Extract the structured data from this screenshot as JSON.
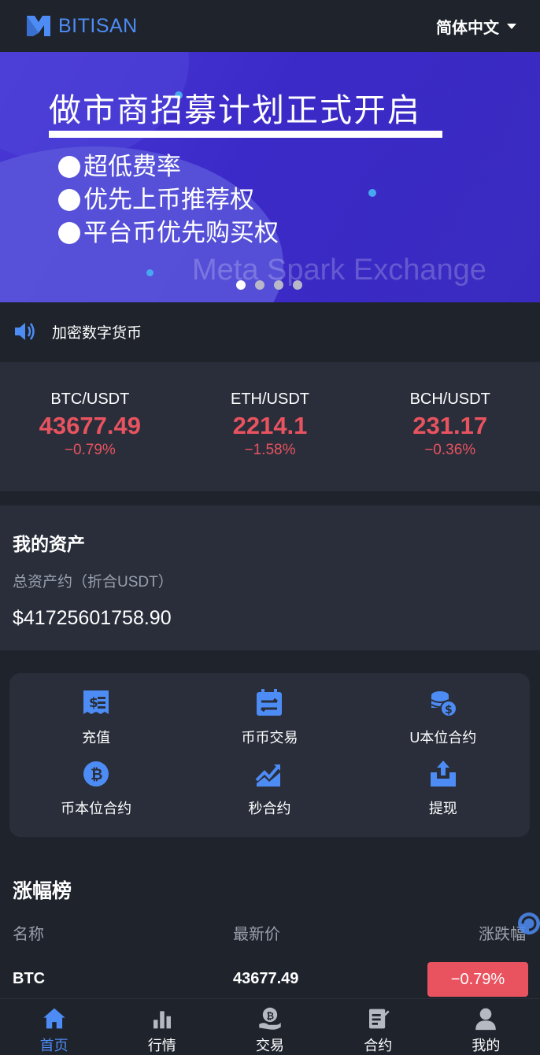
{
  "header": {
    "brand": "BITISAN",
    "language": "简体中文",
    "brand_color": "#4d8cf5"
  },
  "banner": {
    "title": "做市商招募计划正式开启",
    "items": [
      "超低费率",
      "优先上币推荐权",
      "平台币优先购买权"
    ],
    "watermark": "Meta Spark Exchange",
    "slide_count": 4,
    "active_slide": 1
  },
  "notice": {
    "icon": "speaker-icon",
    "text": "加密数字货币"
  },
  "tickers": [
    {
      "pair": "BTC/USDT",
      "price": "43677.49",
      "change": "−0.79%"
    },
    {
      "pair": "ETH/USDT",
      "price": "2214.1",
      "change": "−1.58%"
    },
    {
      "pair": "BCH/USDT",
      "price": "231.17",
      "change": "−0.36%"
    }
  ],
  "assets": {
    "title": "我的资产",
    "subtitle": "总资产约（折合USDT）",
    "value": "$41725601758.90"
  },
  "menu": [
    {
      "label": "充值",
      "icon": "deposit-icon"
    },
    {
      "label": "币币交易",
      "icon": "spot-trade-icon"
    },
    {
      "label": "U本位合约",
      "icon": "usdt-contract-icon"
    },
    {
      "label": "币本位合约",
      "icon": "coin-contract-icon"
    },
    {
      "label": "秒合约",
      "icon": "second-contract-icon"
    },
    {
      "label": "提现",
      "icon": "withdraw-icon"
    }
  ],
  "gainers": {
    "title": "涨幅榜",
    "columns": [
      "名称",
      "最新价",
      "涨跌幅"
    ],
    "rows": [
      {
        "name": "BTC",
        "price": "43677.49",
        "change": "−0.79%"
      }
    ]
  },
  "tabbar": [
    {
      "label": "首页",
      "icon": "home-icon",
      "active": true
    },
    {
      "label": "行情",
      "icon": "market-icon",
      "active": false
    },
    {
      "label": "交易",
      "icon": "trade-icon",
      "active": false
    },
    {
      "label": "合约",
      "icon": "contract-icon",
      "active": false
    },
    {
      "label": "我的",
      "icon": "profile-icon",
      "active": false
    }
  ],
  "colors": {
    "down": "#e8535f",
    "accent": "#4d8cf5",
    "panel": "#292e3a",
    "background": "#1f232c"
  }
}
